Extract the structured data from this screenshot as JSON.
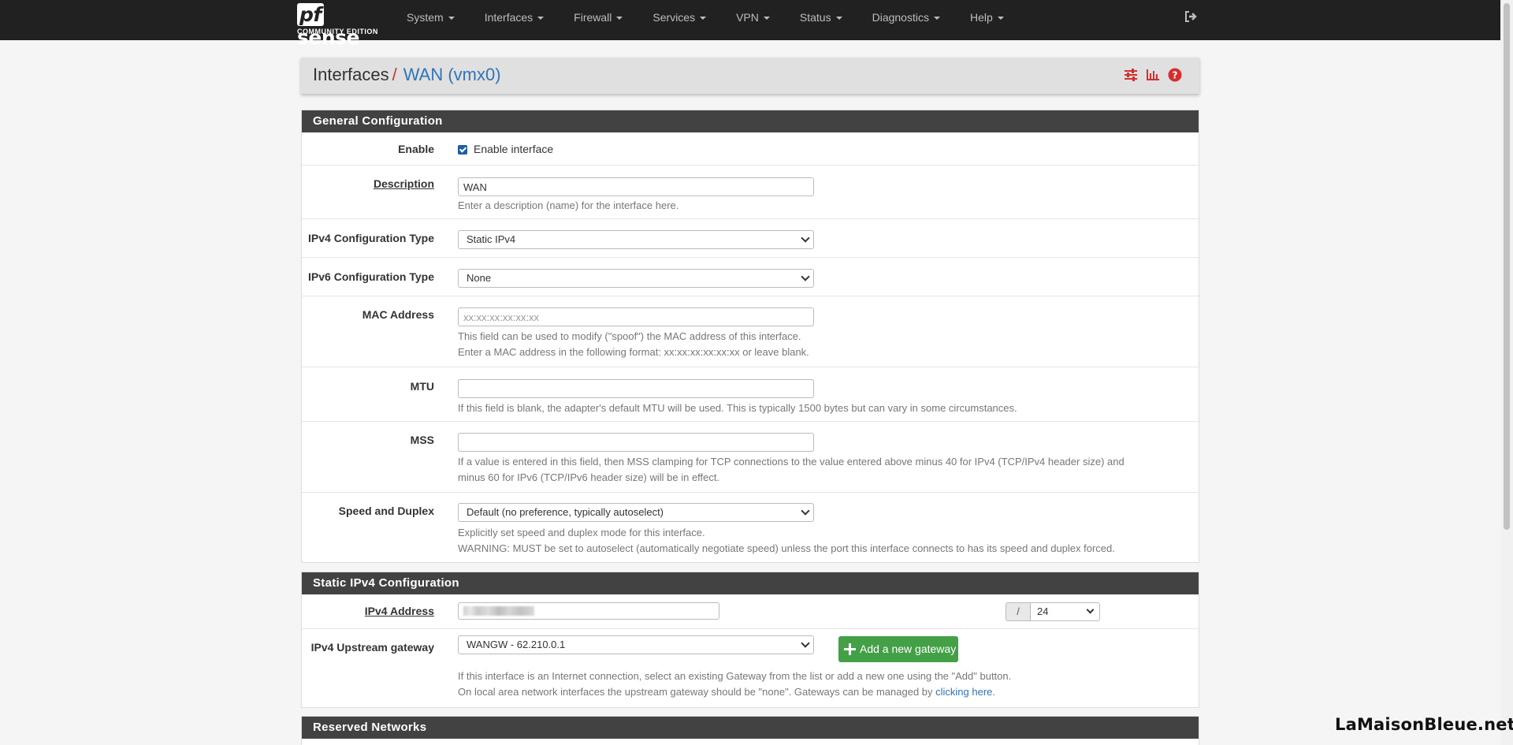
{
  "navbar": {
    "brand": "sense",
    "brand_pf": "pf",
    "edition": "COMMUNITY EDITION",
    "menu": [
      {
        "label": "System"
      },
      {
        "label": "Interfaces"
      },
      {
        "label": "Firewall"
      },
      {
        "label": "Services"
      },
      {
        "label": "VPN"
      },
      {
        "label": "Status"
      },
      {
        "label": "Diagnostics"
      },
      {
        "label": "Help"
      }
    ],
    "logout_icon": "sign-out-icon"
  },
  "header": {
    "breadcrumb_parent": "Interfaces",
    "separator": "/",
    "breadcrumb_current": "WAN (vmx0)",
    "icons": [
      "sliders-icon",
      "bar-chart-icon",
      "question-circle-icon"
    ],
    "accent_color": "#d32f2f",
    "link_color": "#3174b8"
  },
  "general": {
    "heading": "General Configuration",
    "enable": {
      "label": "Enable",
      "checkbox_label": "Enable interface",
      "checked": true
    },
    "description": {
      "label": "Description",
      "value": "WAN",
      "help": "Enter a description (name) for the interface here."
    },
    "ipv4_type": {
      "label": "IPv4 Configuration Type",
      "value": "Static IPv4"
    },
    "ipv6_type": {
      "label": "IPv6 Configuration Type",
      "value": "None"
    },
    "mac": {
      "label": "MAC Address",
      "placeholder": "xx:xx:xx:xx:xx:xx",
      "help1": "This field can be used to modify (\"spoof\") the MAC address of this interface.",
      "help2": "Enter a MAC address in the following format: xx:xx:xx:xx:xx:xx or leave blank."
    },
    "mtu": {
      "label": "MTU",
      "value": "",
      "help": "If this field is blank, the adapter's default MTU will be used. This is typically 1500 bytes but can vary in some circumstances."
    },
    "mss": {
      "label": "MSS",
      "value": "",
      "help1": "If a value is entered in this field, then MSS clamping for TCP connections to the value entered above minus 40 for IPv4 (TCP/IPv4 header size) and",
      "help2": "minus 60 for IPv6 (TCP/IPv6 header size) will be in effect."
    },
    "speed": {
      "label": "Speed and Duplex",
      "value": "Default (no preference, typically autoselect)",
      "help1": "Explicitly set speed and duplex mode for this interface.",
      "help2": "WARNING: MUST be set to autoselect (automatically negotiate speed) unless the port this interface connects to has its speed and duplex forced."
    }
  },
  "static_ipv4": {
    "heading": "Static IPv4 Configuration",
    "address": {
      "label": "IPv4 Address",
      "slash": "/",
      "cidr": "24"
    },
    "gateway": {
      "label": "IPv4 Upstream gateway",
      "value": "WANGW - 62.210.0.1",
      "add_button": "Add a new gateway",
      "help1": "If this interface is an Internet connection, select an existing Gateway from the list or add a new one using the \"Add\" button.",
      "help2_prefix": "On local area network interfaces the upstream gateway should be \"none\". Gateways can be managed by ",
      "help2_link": "clicking here",
      "help2_suffix": "."
    }
  },
  "reserved": {
    "heading": "Reserved Networks"
  },
  "watermark": "LaMaisonBleue.net"
}
